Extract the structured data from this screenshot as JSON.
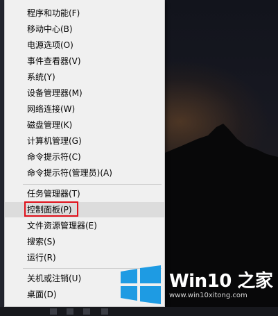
{
  "menu": {
    "items": [
      {
        "label": "程序和功能(F)"
      },
      {
        "label": "移动中心(B)"
      },
      {
        "label": "电源选项(O)"
      },
      {
        "label": "事件查看器(V)"
      },
      {
        "label": "系统(Y)"
      },
      {
        "label": "设备管理器(M)"
      },
      {
        "label": "网络连接(W)"
      },
      {
        "label": "磁盘管理(K)"
      },
      {
        "label": "计算机管理(G)"
      },
      {
        "label": "命令提示符(C)"
      },
      {
        "label": "命令提示符(管理员)(A)"
      },
      {
        "label": "任务管理器(T)"
      },
      {
        "label": "控制面板(P)"
      },
      {
        "label": "文件资源管理器(E)"
      },
      {
        "label": "搜索(S)"
      },
      {
        "label": "运行(R)"
      },
      {
        "label": "关机或注销(U)"
      },
      {
        "label": "桌面(D)"
      }
    ]
  },
  "watermark": {
    "brand": "Win10 之家",
    "url": "www.win10xitong.com"
  },
  "colors": {
    "highlight_border": "#e0101a",
    "logo_blue": "#1e9be3",
    "menu_bg": "#f0f0f0"
  }
}
